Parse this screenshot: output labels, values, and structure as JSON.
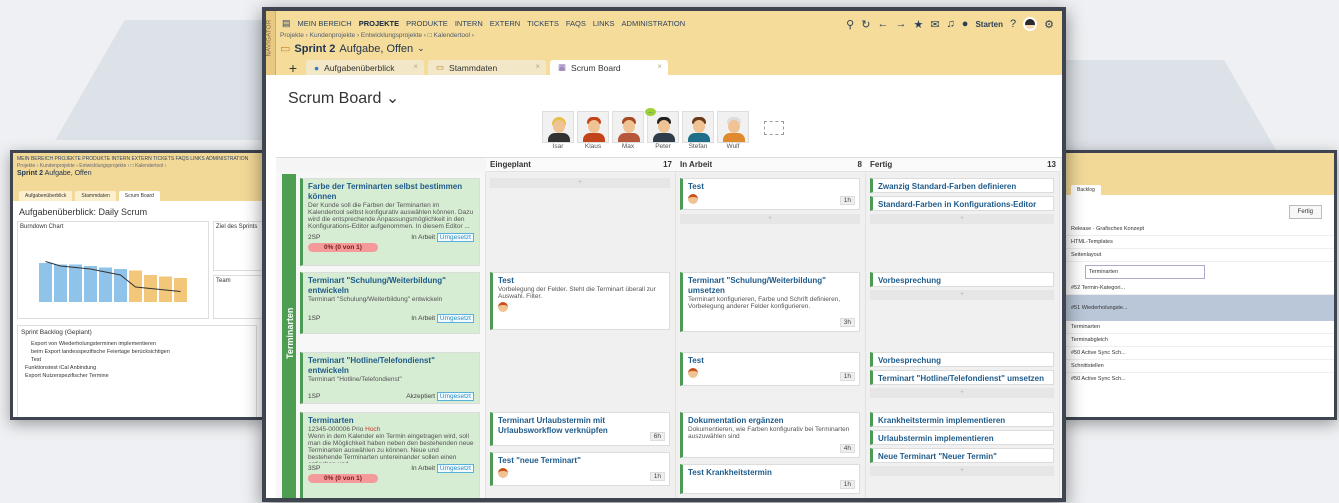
{
  "menu": {
    "items": [
      "MEIN BEREICH",
      "PROJEKTE",
      "PRODUKTE",
      "INTERN",
      "EXTERN",
      "TICKETS",
      "FAQS",
      "LINKS",
      "ADMINISTRATION"
    ],
    "active_index": 1,
    "navigator": "NAVIGATOR"
  },
  "breadcrumb": "Projekte › Kundenprojekte › Entwicklungsprojekte › □ Kalendertool ›",
  "page_title": {
    "bold": "Sprint 2",
    "rest": "Aufgabe, Offen"
  },
  "toolbar": {
    "start_label": "Starten"
  },
  "tabs": [
    {
      "label": "Aufgabenüberblick",
      "icon": "info-icon"
    },
    {
      "label": "Stammdaten",
      "icon": "folder-icon"
    },
    {
      "label": "Scrum Board",
      "icon": "board-icon",
      "active": true
    }
  ],
  "board_title": "Scrum Board",
  "team": [
    "Isar",
    "Klaus",
    "Max",
    "Peter",
    "Stefan",
    "Wulf"
  ],
  "columns": [
    {
      "name": "Eingeplant",
      "count": "17"
    },
    {
      "name": "In Arbeit",
      "count": "8"
    },
    {
      "name": "Fertig",
      "count": "13"
    }
  ],
  "lane": "Terminarten",
  "stories": [
    {
      "title": "Farbe der Terminarten selbst bestimmen können",
      "text": "Der Kunde soll die Farben der Terminarten im Kalendertool selbst konfigurativ auswählen können. Dazu wird die entsprechende Anpassungsmöglichkeit in den Konfigurations-Editor aufgenommen. In diesem Editor ...",
      "sp": "2SP",
      "status": "In Arbeit",
      "badge": "Umgesetzt",
      "progress": "0% (0 von 1)"
    },
    {
      "title": "Terminart \"Schulung/Weiterbildung\" entwickeln",
      "text": "Terminart \"Schulung/Weiterbildung\" entwickeln",
      "sp": "1SP",
      "status": "In Arbeit",
      "badge": "Umgesetzt"
    },
    {
      "title": "Terminart \"Hotline/Telefondienst\" entwickeln",
      "text": "Terminart \"Hotline/Telefondienst\"",
      "sp": "1SP",
      "status": "Akzeptiert",
      "badge": "Umgesetzt"
    },
    {
      "title": "Terminarten",
      "id": "12345-000006",
      "prio": "Prio",
      "prio_value": "Hoch",
      "text": "Wenn in dem Kalender ein Termin eingetragen wird, soll man die Möglichkeit haben neben den bestehenden neue Terminarten auswählen zu können. Neue und bestehende Terminarten untereinander sollen einen optischen und ...",
      "sp": "3SP",
      "status": "In Arbeit",
      "badge": "Umgesetzt",
      "progress": "0% (0 von 1)"
    }
  ],
  "eingeplant": [
    {
      "title": "Test",
      "text": "Vorbelegung der Felder. Steht die Terminart überall zur Auswahl. Filter."
    },
    {
      "title": "Terminart Urlaubstermin mit Urlaubsworkflow verknüpfen",
      "hours": "6h"
    },
    {
      "title": "Test \"neue Terminart\"",
      "hours": "1h"
    }
  ],
  "in_arbeit": [
    {
      "title": "Test",
      "hours": "1h"
    },
    {
      "title": "Terminart \"Schulung/Weiterbildung\" umsetzen",
      "text": "Terminart konfigurieren, Farbe und Schrift definieren, Vorbelegung anderer Felder konfigurieren.",
      "hours": "3h"
    },
    {
      "title": "Test",
      "hours": "1h"
    },
    {
      "title": "Dokumentation ergänzen",
      "text": "Dokumentieren, wie Farben konfigurativ bei Terminarten auszuwählen sind",
      "hours": "4h"
    },
    {
      "title": "Test Krankheitstermin",
      "hours": "1h"
    }
  ],
  "fertig": [
    "Zwanzig Standard-Farben definieren",
    "Standard-Farben in Konfigurations-Editor pr...",
    "Vorbesprechung",
    "Vorbesprechung",
    "Terminart \"Hotline/Telefondienst\" umsetzen",
    "Krankheitstermin implementieren",
    "Urlaubstermin implementieren",
    "Neue Terminart \"Neuer Termin\" implementie..."
  ],
  "left_window": {
    "title": "Aufgabenüberblick: Daily Scrum",
    "chart": "Burndown Chart",
    "goal": "Ziel des Sprints",
    "team": "Team",
    "backlog": "Sprint Backlog (Geplant)",
    "tab_labels": [
      "Aufgabenüberblick",
      "Stammdaten",
      "Scrum Board"
    ],
    "rows": [
      "Export von Wiederholungsterminen implementieren",
      "beim Export landesspezifische Feiertage berücksichtigen",
      "Test",
      "Funktionstest iCal Anbindung",
      "Export Nutzerspezifischer Termine"
    ]
  },
  "right_window": {
    "tab": "Backlog",
    "button": "Fertig",
    "rows": [
      "Terminarten",
      "#52 Termin-Kategori...",
      "#51 Wiederholungste...",
      "#50 Active Sync Sch...",
      "#50 Active Sync Sch..."
    ],
    "links": [
      "Grafisches Konzept",
      "HTML-Templates",
      "Seitenlayout",
      "Terminarten",
      "Terminabgleich",
      "Schnittstellen"
    ]
  },
  "chart_data": {
    "type": "bar",
    "title": "Burndown Chart",
    "values": [
      26,
      25,
      25,
      24,
      23,
      22,
      21,
      18,
      17,
      16
    ],
    "line": [
      27,
      24,
      23,
      22,
      20,
      18,
      10,
      9,
      8,
      7
    ]
  }
}
